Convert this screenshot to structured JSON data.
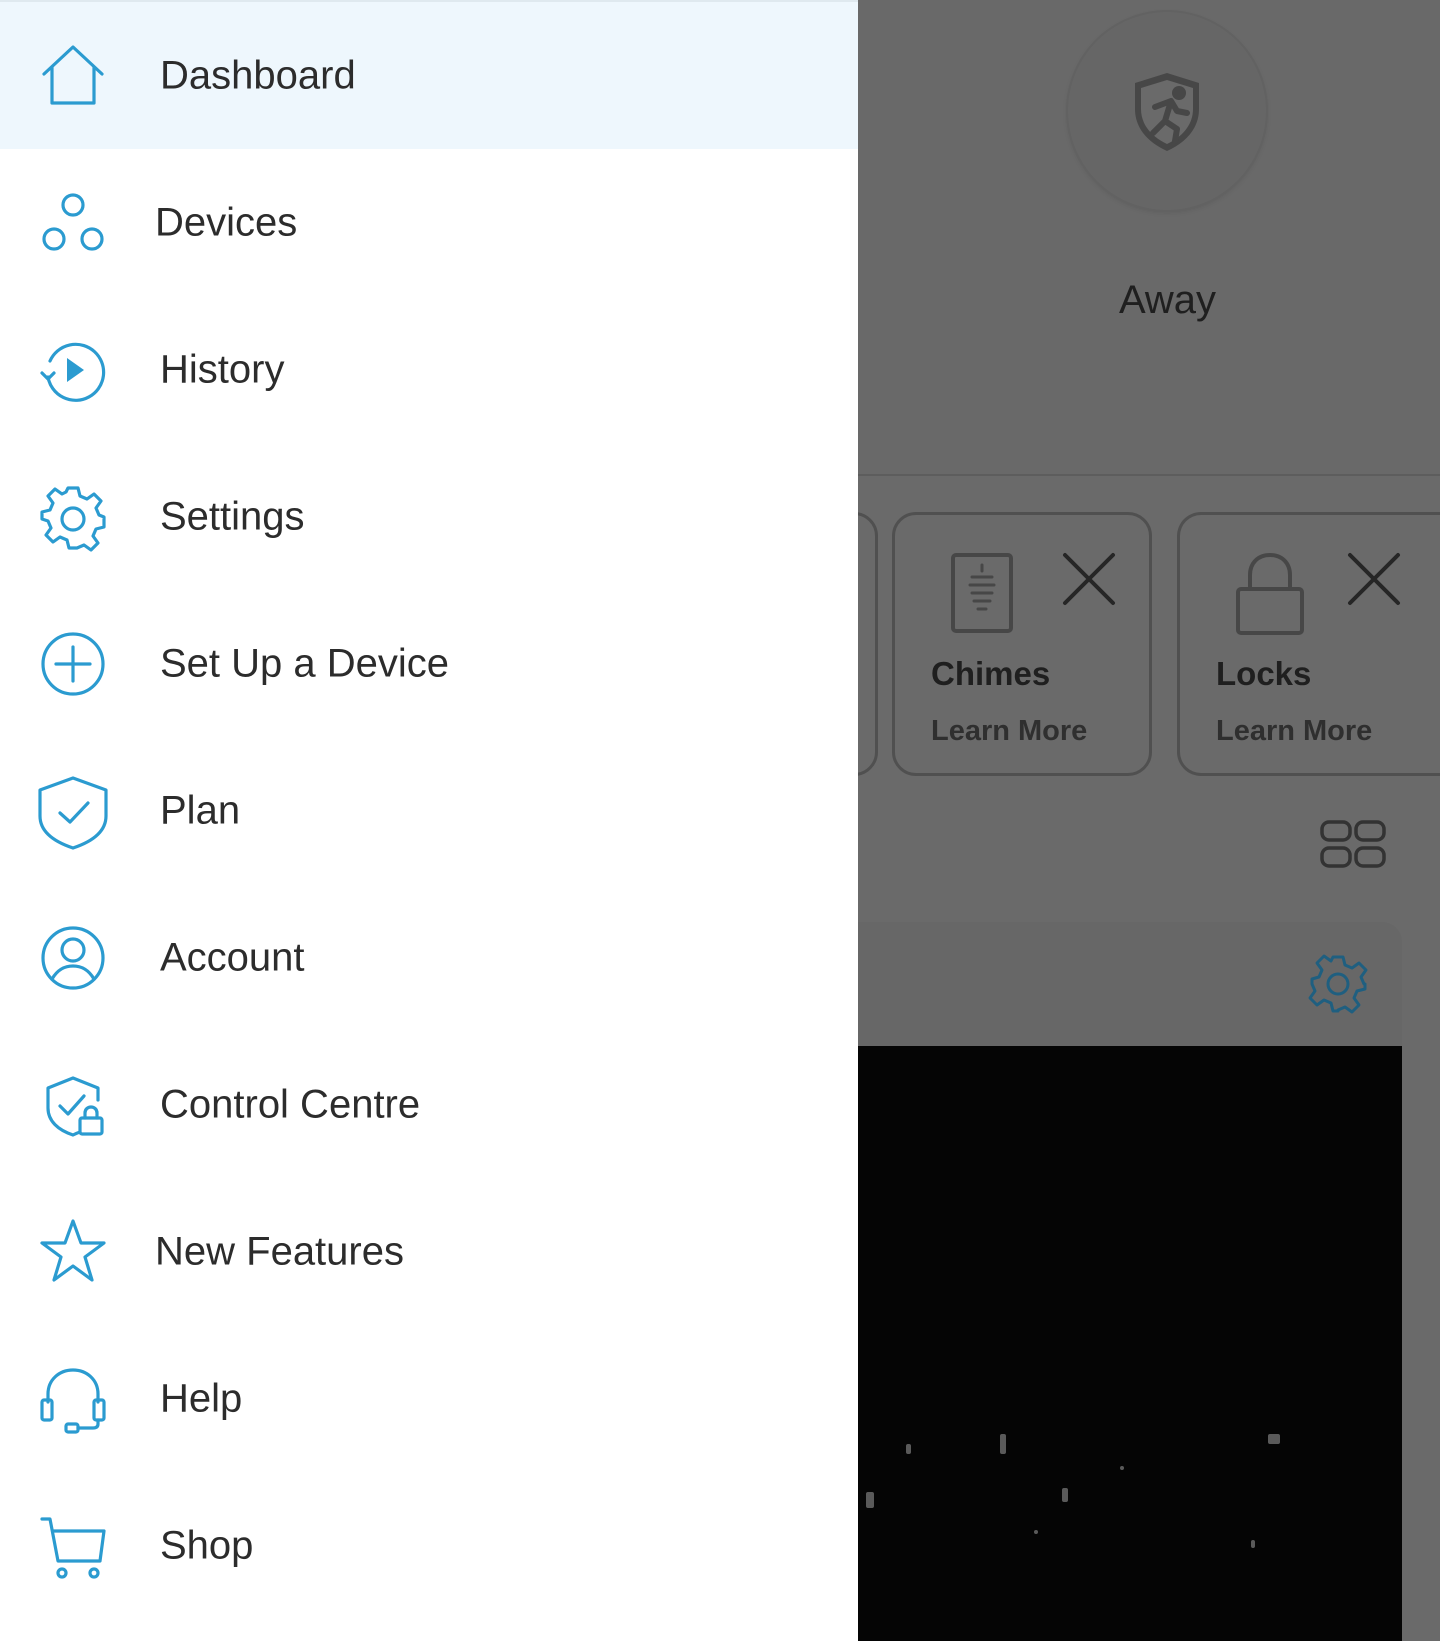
{
  "drawer": {
    "items": [
      {
        "label": "Dashboard",
        "icon": "home-icon",
        "active": true
      },
      {
        "label": "Devices",
        "icon": "devices-icon"
      },
      {
        "label": "History",
        "icon": "history-icon"
      },
      {
        "label": "Settings",
        "icon": "gear-icon"
      },
      {
        "label": "Set Up a Device",
        "icon": "plus-circle-icon"
      },
      {
        "label": "Plan",
        "icon": "shield-check-icon"
      },
      {
        "label": "Account",
        "icon": "user-circle-icon"
      },
      {
        "label": "Control Centre",
        "icon": "shield-lock-icon"
      },
      {
        "label": "New Features",
        "icon": "star-icon"
      },
      {
        "label": "Help",
        "icon": "headset-icon"
      },
      {
        "label": "Shop",
        "icon": "cart-icon"
      }
    ]
  },
  "background": {
    "mode": {
      "label": "Away",
      "icon": "shield-running-person-icon"
    },
    "cards": [
      {
        "title": "Chimes",
        "link": "Learn More",
        "icon": "chime-icon"
      },
      {
        "title": "Locks",
        "link": "Learn More",
        "icon": "lock-icon"
      }
    ]
  },
  "colors": {
    "accent": "#2b9bd0",
    "active_row": "#eef7fd",
    "overlay": "#6a6a6a"
  }
}
